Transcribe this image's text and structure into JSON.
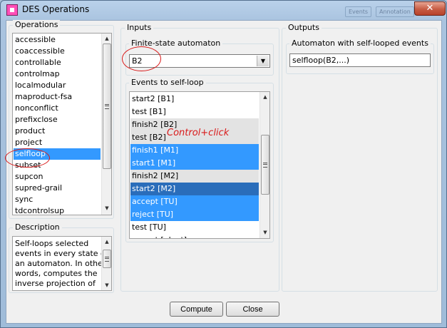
{
  "window": {
    "title": "DES Operations",
    "close_label": "✕",
    "ghost_tabs": [
      "Events",
      "Annotation"
    ]
  },
  "operations": {
    "legend": "Operations",
    "items": [
      "accessible",
      "coaccessible",
      "controllable",
      "controlmap",
      "localmodular",
      "maproduct-fsa",
      "nonconflict",
      "prefixclose",
      "product",
      "project",
      "selfloop",
      "subset",
      "supcon",
      "supred-grail",
      "sync",
      "tdcontrolsup"
    ],
    "selected": "selfloop"
  },
  "description": {
    "legend": "Description",
    "lines": [
      "Self-loops selected",
      "events in every state of",
      "an automaton. In other",
      "words, computes the",
      "inverse projection of"
    ]
  },
  "inputs": {
    "legend": "Inputs",
    "automaton_legend": "Finite-state automaton",
    "automaton_value": "B2",
    "events_legend": "Events to self-loop",
    "events": [
      {
        "label": "start2 [B1]",
        "state": "normal"
      },
      {
        "label": "test [B1]",
        "state": "normal"
      },
      {
        "label": "finish2 [B2]",
        "state": "grey"
      },
      {
        "label": "test [B2]",
        "state": "grey"
      },
      {
        "label": "finish1 [M1]",
        "state": "selected"
      },
      {
        "label": "start1 [M1]",
        "state": "selected"
      },
      {
        "label": "finish2 [M2]",
        "state": "grey"
      },
      {
        "label": "start2 [M2]",
        "state": "focused"
      },
      {
        "label": "accept [TU]",
        "state": "selected"
      },
      {
        "label": "reject [TU]",
        "state": "selected"
      },
      {
        "label": "test [TU]",
        "state": "normal"
      },
      {
        "label": "accept [plant]",
        "state": "normal"
      }
    ],
    "annotation": "Control+click"
  },
  "outputs": {
    "legend": "Outputs",
    "automaton_legend": "Automaton with self-looped events",
    "automaton_value": "selfloop(B2,...)"
  },
  "buttons": {
    "compute": "Compute",
    "close": "Close"
  },
  "colors": {
    "selection": "#3399ff",
    "focused": "#2a6dba",
    "annotation": "#d91a1a"
  }
}
